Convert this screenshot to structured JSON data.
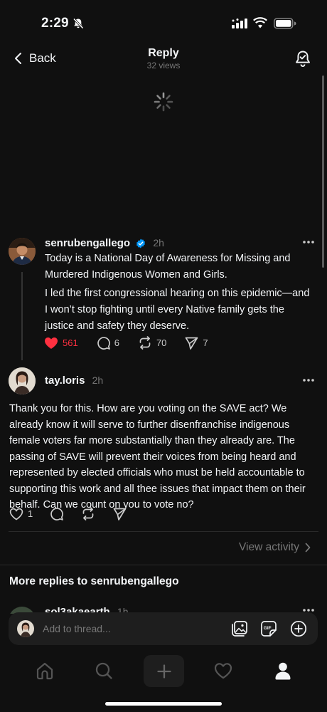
{
  "status_bar": {
    "time": "2:29"
  },
  "header": {
    "back_label": "Back",
    "title": "Reply",
    "subtitle": "32 views"
  },
  "original_post": {
    "username": "senrubengallego",
    "time": "2h",
    "paragraphs": [
      "Today is a National Day of Awareness for Missing and Murdered Indigenous Women and Girls.",
      "I led the first congressional hearing on this epidemic—and I won’t stop fighting until every Native family gets the justice and safety they deserve."
    ],
    "likes": "561",
    "replies": "6",
    "reposts": "70",
    "shares": "7"
  },
  "reply_post": {
    "username": "tay.loris",
    "time": "2h",
    "text": "Thank you for this. How are you voting on the SAVE act?  We already know it will serve to further disenfranchise indigenous female voters far more substantially than they already are. The passing of SAVE will prevent their voices from being heard and represented by elected officials who must be held accountable to supporting this work and all thee issues that impact them on their behalf. Can we count on you to vote no?",
    "likes": "1"
  },
  "view_activity_label": "View activity",
  "more_replies": {
    "heading": "More replies to senrubengallego",
    "preview_username": "sol3akaearth",
    "preview_time": "1h"
  },
  "reply_bar": {
    "placeholder": "Add to thread..."
  },
  "colors": {
    "background": "#101010",
    "like_red": "#ff3040",
    "verified_blue": "#0095f6",
    "muted": "#777777"
  }
}
